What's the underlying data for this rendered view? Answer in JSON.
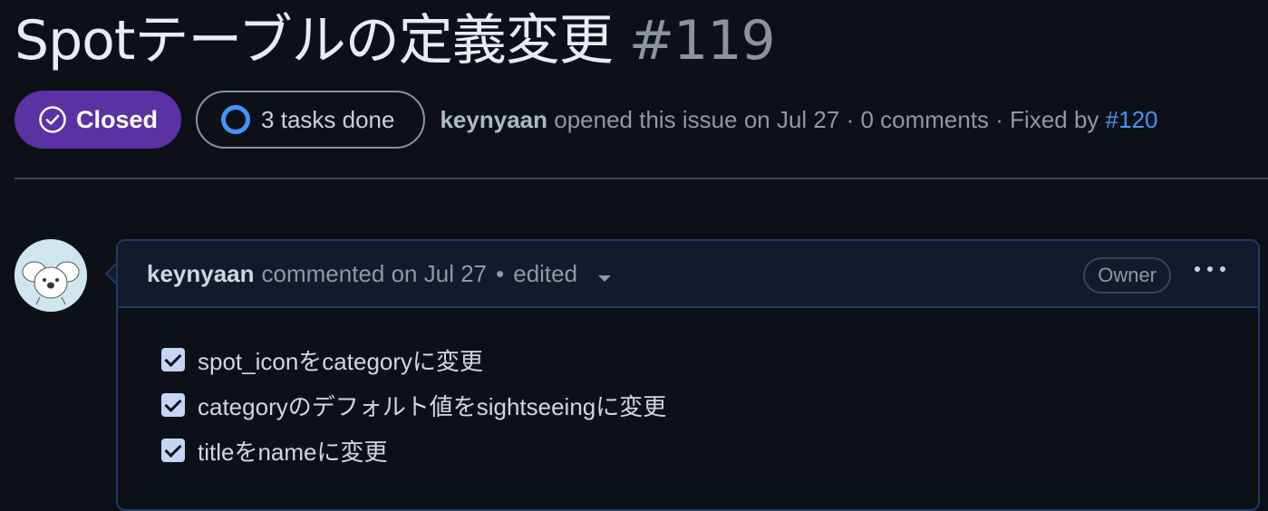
{
  "issue": {
    "title": "Spotテーブルの定義変更",
    "number": "#119",
    "state": "Closed",
    "tasks_label": "3 tasks done",
    "author": "keynyaan",
    "opened_text": "opened this issue on Jul 27 · 0 comments · Fixed by",
    "fixed_by": "#120"
  },
  "comment": {
    "author": "keynyaan",
    "action": "commented on Jul 27",
    "separator": "•",
    "edited_label": "edited",
    "role_badge": "Owner",
    "tasks": [
      {
        "label": "spot_iconをcategoryに変更",
        "checked": true
      },
      {
        "label": "categoryのデフォルト値をsightseeingに変更",
        "checked": true
      },
      {
        "label": "titleをnameに変更",
        "checked": true
      }
    ]
  },
  "colors": {
    "closed_badge": "#5a32a3",
    "link": "#4493f8",
    "background": "#0d1117"
  },
  "icons": {
    "state_icon": "check-circle-icon",
    "tasks_icon": "progress-ring-icon",
    "menu_icon": "kebab-horizontal-icon"
  }
}
